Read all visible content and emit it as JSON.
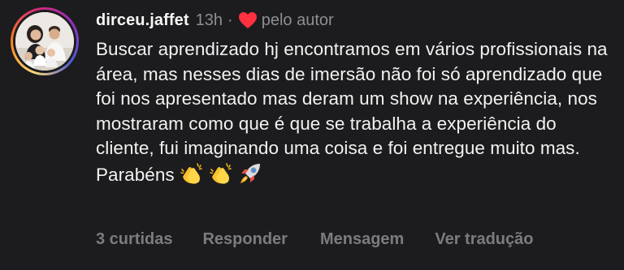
{
  "comment": {
    "username": "dirceu.jaffet",
    "time": "13h",
    "separator": "·",
    "liked_by_author": "pelo autor",
    "text": "Buscar aprendizado hj encontramos em vários profissionais na área, mas nesses dias de imersão não foi só aprendizado que foi nos apresentado mas deram um show na experiência, nos mostraram como que é que se trabalha a experiência do cliente, fui imaginando uma coisa e foi entregue muito mas. Parabéns",
    "emoji_icons": [
      "clapping-hands-icon",
      "clapping-hands-icon",
      "rocket-icon"
    ],
    "colors": {
      "background": "#1c1c1e",
      "text": "#f2f2f2",
      "muted": "#8e8e93",
      "heart": "#ff3040"
    }
  },
  "actions": {
    "likes": "3 curtidas",
    "reply": "Responder",
    "message": "Mensagem",
    "translate": "Ver tradução"
  }
}
